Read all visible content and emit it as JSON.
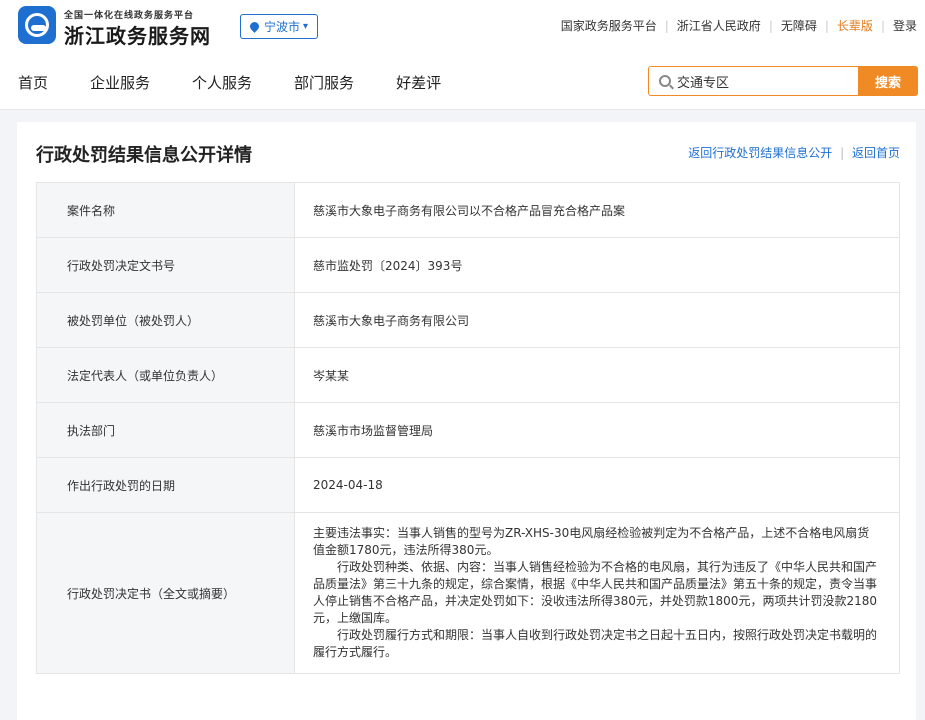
{
  "header": {
    "brand_small": "全国一体化在线政务服务平台",
    "brand_big": "浙江政务服务网",
    "city": "宁波市",
    "city_arrow": "▾",
    "toplinks": [
      "国家政务服务平台",
      "浙江省人民政府",
      "无障碍",
      "长辈版",
      "登录"
    ],
    "nav": [
      "首页",
      "企业服务",
      "个人服务",
      "部门服务",
      "好差评"
    ],
    "search_value": "交通专区",
    "search_button": "搜索",
    "accent_color": "#f08a24",
    "brand_color": "#1f6fd1"
  },
  "page": {
    "title": "行政处罚结果信息公开详情",
    "back_list": "返回行政处罚结果信息公开",
    "back_home": "返回首页",
    "rows": [
      {
        "label": "案件名称",
        "value": "慈溪市大象电子商务有限公司以不合格产品冒充合格产品案"
      },
      {
        "label": "行政处罚决定文书号",
        "value": "慈市监处罚〔2024〕393号"
      },
      {
        "label": "被处罚单位（被处罚人）",
        "value": "慈溪市大象电子商务有限公司"
      },
      {
        "label": "法定代表人（或单位负责人）",
        "value": "岑某某"
      },
      {
        "label": "执法部门",
        "value": "慈溪市市场监督管理局"
      },
      {
        "label": "作出行政处罚的日期",
        "value": "2024-04-18"
      }
    ],
    "decision": {
      "label": "行政处罚决定书（全文或摘要）",
      "para1": "主要违法事实：当事人销售的型号为ZR-XHS-30电风扇经检验被判定为不合格产品，上述不合格电风扇货值金额1780元，违法所得380元。",
      "para2": "行政处罚种类、依据、内容：当事人销售经检验为不合格的电风扇，其行为违反了《中华人民共和国产品质量法》第三十九条的规定，综合案情，根据《中华人民共和国产品质量法》第五十条的规定，责令当事人停止销售不合格产品，并决定处罚如下：没收违法所得380元，并处罚款1800元，两项共计罚没款2180元，上缴国库。",
      "para3": "行政处罚履行方式和期限：当事人自收到行政处罚决定书之日起十五日内，按照行政处罚决定书载明的履行方式履行。"
    }
  }
}
